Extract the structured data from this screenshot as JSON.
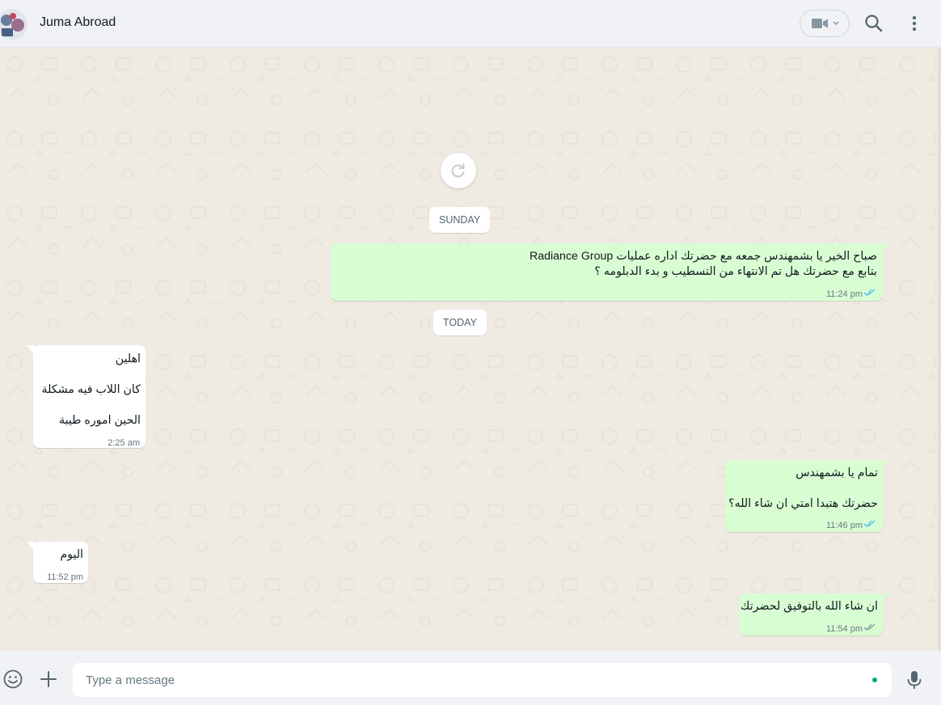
{
  "header": {
    "contact_name": "Juma Abroad",
    "icons": [
      "avatar",
      "video-call-icon",
      "chevron-down-icon",
      "search-icon",
      "menu-icon"
    ]
  },
  "chat": {
    "reload_icon": "refresh-icon",
    "date_sunday": "SUNDAY",
    "date_today": "TODAY",
    "messages": [
      {
        "direction": "outgoing",
        "lines": [
          "صباح الخير يا بشمهندس جمعه مع  حضرتك اداره عمليات Radiance Group",
          "بتابع مع حضرتك هل تم الانتهاء من التسطيب و بدء الدبلومه ؟"
        ],
        "time": "11:24 pm",
        "status": "read"
      },
      {
        "direction": "incoming",
        "lines": [
          "اهلين",
          "كان اللاب فيه مشكلة",
          "الحين اموره طيبة"
        ],
        "time": "2:25 am"
      },
      {
        "direction": "outgoing",
        "lines": [
          "تمام يا بشمهندس",
          "حضرتك هتبدا امتي ان شاء الله؟"
        ],
        "time": "11:46 pm",
        "status": "read"
      },
      {
        "direction": "incoming",
        "lines": [
          "اليوم"
        ],
        "time": "11:52 pm"
      },
      {
        "direction": "outgoing",
        "lines": [
          "ان شاء الله بالتوفيق لحضرتك"
        ],
        "time": "11:54 pm",
        "status": "delivered"
      }
    ]
  },
  "footer": {
    "placeholder": "Type a message",
    "icons": [
      "emoji-icon",
      "plus-icon",
      "microphone-icon"
    ]
  },
  "colors": {
    "outgoing_bubble": "#d9fdd3",
    "incoming_bubble": "#ffffff",
    "chat_background": "#efeae2",
    "read_ticks": "#53bdeb",
    "delivered_ticks": "#8696a0"
  }
}
